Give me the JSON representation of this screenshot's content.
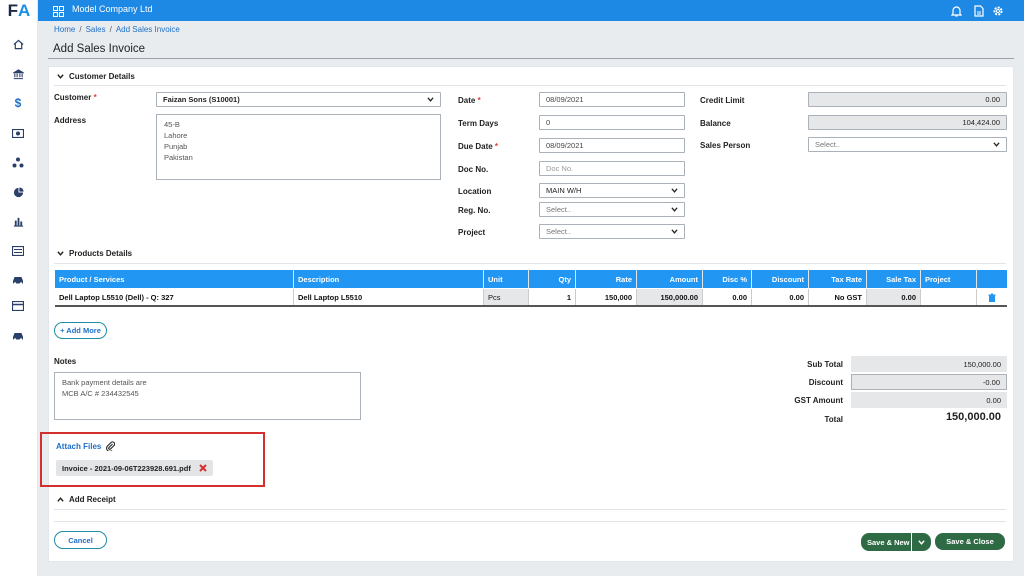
{
  "app": {
    "logo_f": "F",
    "logo_a": "A",
    "company": "Model Company Ltd"
  },
  "sidebar": {
    "icons": [
      "home-icon",
      "bank-icon",
      "dollar-icon",
      "cash-icon",
      "network-icon",
      "pie-chart-icon",
      "bar-chart-icon",
      "list-icon",
      "car-icon",
      "card-icon",
      "truck-icon"
    ]
  },
  "breadcrumb": {
    "home": "Home",
    "sales": "Sales",
    "current": "Add Sales Invoice",
    "sep": "/"
  },
  "page": {
    "title": "Add Sales Invoice"
  },
  "customer_section": {
    "title": "Customer Details"
  },
  "form": {
    "customer_label": "Customer",
    "customer_value": "Faizan Sons (S10001)",
    "address_label": "Address",
    "address_value": "45-B\nLahore\nPunjab\nPakistan",
    "date_label": "Date",
    "date_value": "08/09/2021",
    "term_days_label": "Term Days",
    "term_days_value": "0",
    "due_date_label": "Due Date",
    "due_date_value": "08/09/2021",
    "doc_no_label": "Doc No.",
    "doc_no_placeholder": "Doc No.",
    "location_label": "Location",
    "location_value": "MAIN W/H",
    "reg_no_label": "Reg. No.",
    "reg_no_placeholder": "Select..",
    "project_label": "Project",
    "project_placeholder": "Select..",
    "credit_limit_label": "Credit Limit",
    "credit_limit_value": "0.00",
    "balance_label": "Balance",
    "balance_value": "104,424.00",
    "sales_person_label": "Sales Person",
    "sales_person_placeholder": "Select..",
    "required_mark": "*"
  },
  "products_section": {
    "title": "Products Details"
  },
  "table": {
    "headers": [
      "Product / Services",
      "Description",
      "Unit",
      "Qty",
      "Rate",
      "Amount",
      "Disc %",
      "Discount",
      "Tax Rate",
      "Sale Tax",
      "Project",
      ""
    ],
    "rows": [
      [
        "Dell Laptop L5510 (Dell) - Q: 327",
        "Dell Laptop L5510",
        "Pcs",
        "1",
        "150,000",
        "150,000.00",
        "0.00",
        "0.00",
        "No GST",
        "0.00",
        "",
        ""
      ]
    ]
  },
  "add_more": "+ Add More",
  "notes": {
    "label": "Notes",
    "value": "Bank payment details are\nMCB A/C # 234432545"
  },
  "totals": {
    "sub_total_label": "Sub Total",
    "sub_total": "150,000.00",
    "discount_label": "Discount",
    "discount": "-0.00",
    "gst_label": "GST Amount",
    "gst": "0.00",
    "total_label": "Total",
    "total": "150,000.00"
  },
  "attach": {
    "label": "Attach Files",
    "file": "Invoice - 2021-09-06T223928.691.pdf"
  },
  "receipt": {
    "title": "Add Receipt"
  },
  "buttons": {
    "cancel": "Cancel",
    "save_new": "Save & New",
    "save_close": "Save & Close"
  },
  "colors": {
    "topbar": "#1e88e5",
    "table_header": "#2196f3",
    "save": "#2e6b45",
    "highlight": "#d32f2f"
  }
}
